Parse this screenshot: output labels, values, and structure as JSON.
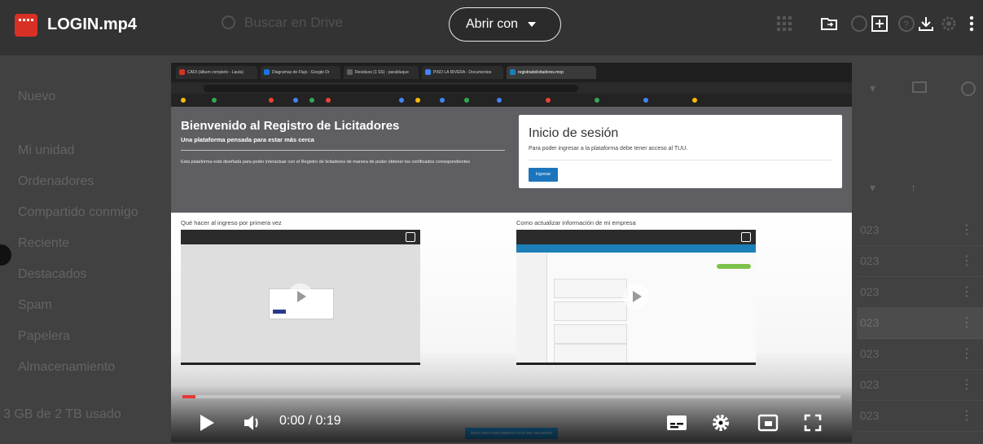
{
  "file": {
    "name": "LOGIN.mp4",
    "icon": "video-file-icon"
  },
  "toolbar": {
    "open_with_label": "Abrir con",
    "search_placeholder": "Buscar en Drive",
    "icons": [
      "grid-apps-icon",
      "move-to-folder-icon",
      "add-shortcut-icon",
      "help-icon",
      "download-icon",
      "settings-icon",
      "more-vert-icon"
    ]
  },
  "background": {
    "new_label": "Nuevo",
    "sidebar": [
      "Mi unidad",
      "Ordenadores",
      "Compartido conmigo",
      "Reciente",
      "Destacados",
      "Spam",
      "Papelera",
      "Almacenamiento"
    ],
    "storage": "3 GB de 2 TB usado",
    "rows": [
      "023",
      "023",
      "023",
      "023",
      "023",
      "023",
      "023"
    ]
  },
  "video": {
    "welcome_title": "Bienvenido al Registro de Licitadores",
    "welcome_subtitle": "Una plataforma pensada para estar más cerca",
    "welcome_desc": "Esta plataforma está diseñada para poder interactuar con el Registro de licitadores de manera de poder obtener los certificados correspondientes",
    "login_title": "Inicio de sesión",
    "login_text": "Para poder ingresar a la plataforma debe tener acceso al TUU.",
    "login_button": "Ingresar",
    "section_left": "Qué hacer al ingreso por primera vez",
    "section_right": "Como actualizar información de mi empresa",
    "bottom_button": "DESCARGA DOCUMENTO GUÍA DE USUARIOS",
    "time": "0:00 / 0:19",
    "progress": 0.02,
    "tabs": [
      "CÁDI (álbum completo - Lauta)",
      "Diagramas de Flujo - Google Dr",
      "Residuos (1 SS) - parabluque",
      "PISO LA RIVERA - Documentos",
      "registradolicitadores.mop"
    ]
  },
  "player_controls": [
    "play-icon",
    "volume-icon",
    "subtitles-icon",
    "settings-icon",
    "miniplayer-icon",
    "fullscreen-icon"
  ]
}
